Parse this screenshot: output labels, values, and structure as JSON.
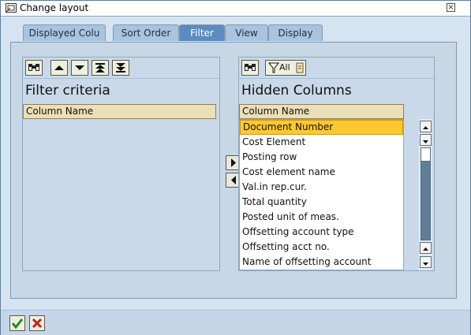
{
  "window": {
    "title": "Change layout"
  },
  "tabs": [
    {
      "label": "Displayed Colu",
      "active": false
    },
    {
      "label": "Sort Order",
      "active": false
    },
    {
      "label": "Filter",
      "active": true
    },
    {
      "label": "View",
      "active": false
    },
    {
      "label": "Display",
      "active": false
    }
  ],
  "left_panel": {
    "title": "Filter criteria",
    "column_header": "Column Name",
    "toolbar": [
      "find-icon",
      "up-icon",
      "down-icon",
      "top-icon",
      "bottom-icon"
    ]
  },
  "right_panel": {
    "title": "Hidden Columns",
    "column_header": "Column Name",
    "toolbar": {
      "filter_label": "All"
    },
    "items": [
      "Document Number",
      "Cost Element",
      "Posting row",
      "Cost element name",
      "Val.in rep.cur.",
      "Total quantity",
      "Posted unit of meas.",
      "Offsetting account type",
      "Offsetting acct no.",
      "Name of offsetting account"
    ],
    "selected_index": 0
  },
  "colors": {
    "tab_active": "#5b8bbf",
    "selection": "#ffc830",
    "header": "#ebdfb7"
  }
}
